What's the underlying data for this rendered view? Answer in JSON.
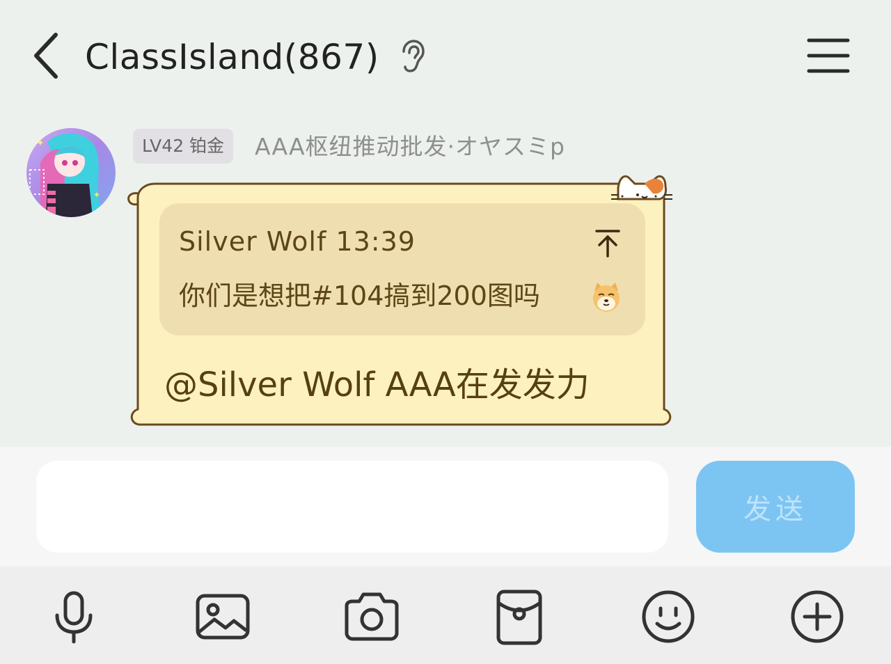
{
  "header": {
    "title": "ClassIsland(867)",
    "back_icon": "chevron-left-icon",
    "ear_icon": "ear-icon",
    "menu_icon": "hamburger-menu-icon"
  },
  "message": {
    "level_badge": "LV42 铂金",
    "sender_name": "AAA枢纽推动批发·オヤスミp",
    "quote": {
      "author_time": "Silver Wolf 13:39",
      "text": "你们是想把#104搞到200图吗",
      "emoji": "shiba-dog-emoji",
      "jump_icon": "arrow-up-to-top-icon"
    },
    "text": "@Silver Wolf AAA在发发力",
    "bubble_color": "#fdf1c0",
    "bubble_border": "#6b4a1f"
  },
  "composer": {
    "input_value": "",
    "send_label": "发送",
    "send_color": "#7cc5f3"
  },
  "toolbar": {
    "icons": [
      "microphone-icon",
      "image-icon",
      "camera-icon",
      "red-packet-icon",
      "emoji-smile-icon",
      "plus-circle-icon"
    ]
  }
}
